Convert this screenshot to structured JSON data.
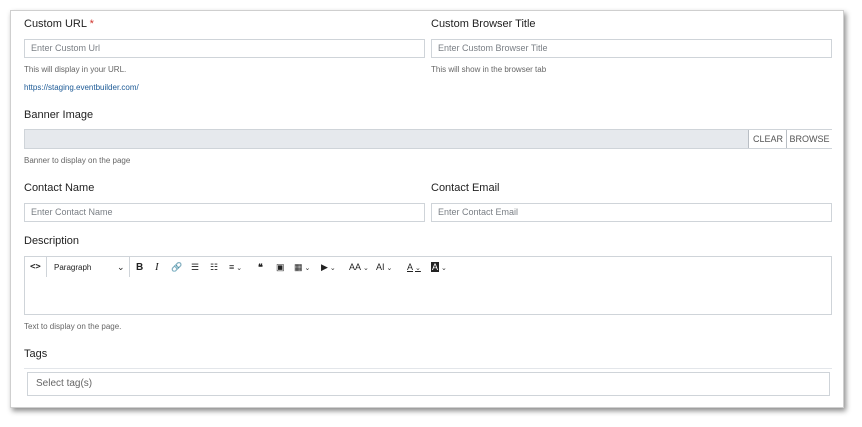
{
  "custom_url": {
    "label": "Custom URL",
    "required_mark": "*",
    "placeholder": "Enter Custom Url",
    "help": "This will display in your URL.",
    "base_url": "https://staging.eventbuilder.com/"
  },
  "custom_title": {
    "label": "Custom Browser Title",
    "placeholder": "Enter Custom Browser Title",
    "help": "This will show in the browser tab"
  },
  "banner": {
    "label": "Banner Image",
    "clear_label": "CLEAR",
    "browse_label": "BROWSE",
    "help": "Banner to display on the page"
  },
  "contact_name": {
    "label": "Contact Name",
    "placeholder": "Enter Contact Name"
  },
  "contact_email": {
    "label": "Contact Email",
    "placeholder": "Enter Contact Email"
  },
  "description": {
    "label": "Description",
    "format_select": "Paragraph",
    "help": "Text to display on the page.",
    "toolbar": {
      "source_icon": "<>",
      "bold": "B",
      "italic": "I",
      "link": "🔗",
      "bullet_list": "☰",
      "numbered_list": "☷",
      "align": "≡",
      "quote": "❝",
      "image": "▣",
      "table": "▦",
      "media": "▶",
      "font_size": "AA",
      "text_case": "AI",
      "font_color": "A",
      "highlight": "A"
    }
  },
  "tags": {
    "label": "Tags",
    "placeholder": "Select tag(s)"
  }
}
